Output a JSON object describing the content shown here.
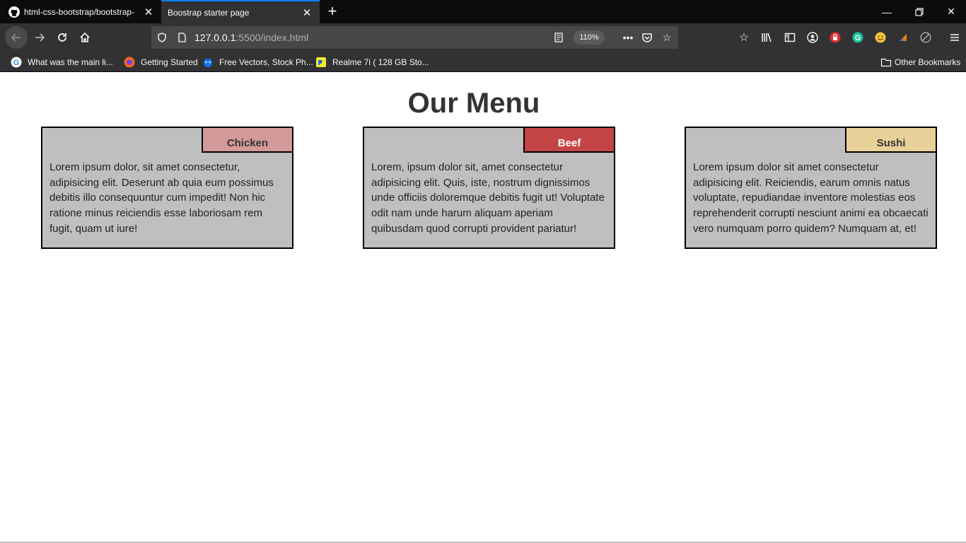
{
  "browser": {
    "tabs": [
      {
        "title": "html-css-bootstrap/bootstrap-"
      },
      {
        "title": "Boostrap starter page"
      }
    ],
    "url": {
      "host": "127.0.0.1",
      "rest": ":5500/index.html"
    },
    "zoom": "110%",
    "bookmarks": [
      {
        "label": "What was the main li...",
        "icon": "google-icon"
      },
      {
        "label": "Getting Started",
        "icon": "firefox-icon"
      },
      {
        "label": "Free Vectors, Stock Ph...",
        "icon": "freepik-icon"
      },
      {
        "label": "Realme 7i ( 128 GB Sto...",
        "icon": "flipkart-icon"
      }
    ],
    "other_bookmarks": "Other Bookmarks"
  },
  "page": {
    "heading": "Our Menu",
    "cards": [
      {
        "label": "Chicken",
        "label_color": "#d49a9a",
        "label_text_color": "#333333",
        "description": "Lorem ipsum dolor, sit amet consectetur, adipisicing elit. Deserunt ab quia eum possimus debitis illo consequuntur cum impedit! Non hic ratione minus reiciendis esse laboriosam rem fugit, quam ut iure!"
      },
      {
        "label": "Beef",
        "label_color": "#c44545",
        "label_text_color": "#ffffff",
        "description": "Lorem, ipsum dolor sit, amet consectetur adipisicing elit. Quis, iste, nostrum dignissimos unde officiis doloremque debitis fugit ut! Voluptate odit nam unde harum aliquam aperiam quibusdam quod corrupti provident pariatur!"
      },
      {
        "label": "Sushi",
        "label_color": "#e8d199",
        "label_text_color": "#333333",
        "description": "Lorem ipsum dolor sit amet consectetur adipisicing elit. Reiciendis, earum omnis natus voluptate, repudiandae inventore molestias eos reprehenderit corrupti nesciunt animi ea obcaecati vero numquam porro quidem? Numquam at, et!"
      }
    ]
  }
}
